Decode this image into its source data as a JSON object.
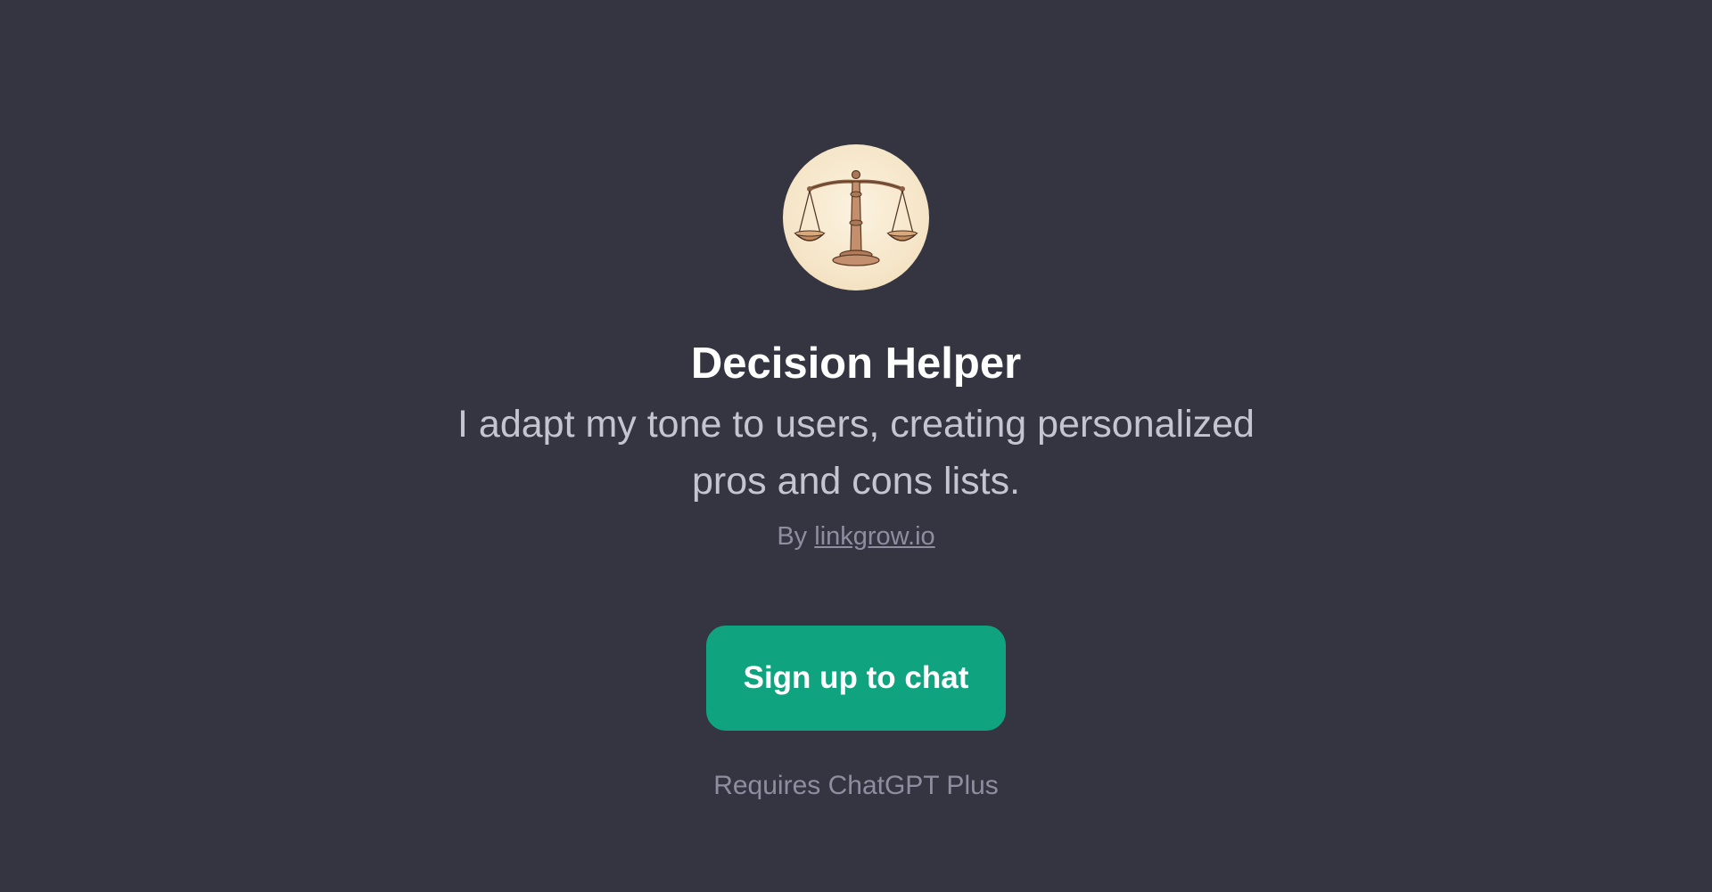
{
  "gpt": {
    "icon": "balance-scale-icon",
    "title": "Decision Helper",
    "description": "I adapt my tone to users, creating personalized pros and cons lists.",
    "byline_prefix": "By",
    "author": "linkgrow.io"
  },
  "actions": {
    "signup_label": "Sign up to chat"
  },
  "footer": {
    "requirement": "Requires ChatGPT Plus"
  },
  "colors": {
    "background": "#343541",
    "accent": "#10a37f",
    "title": "#ffffff",
    "description": "#c5c5d2",
    "muted": "#8e8ea0"
  }
}
